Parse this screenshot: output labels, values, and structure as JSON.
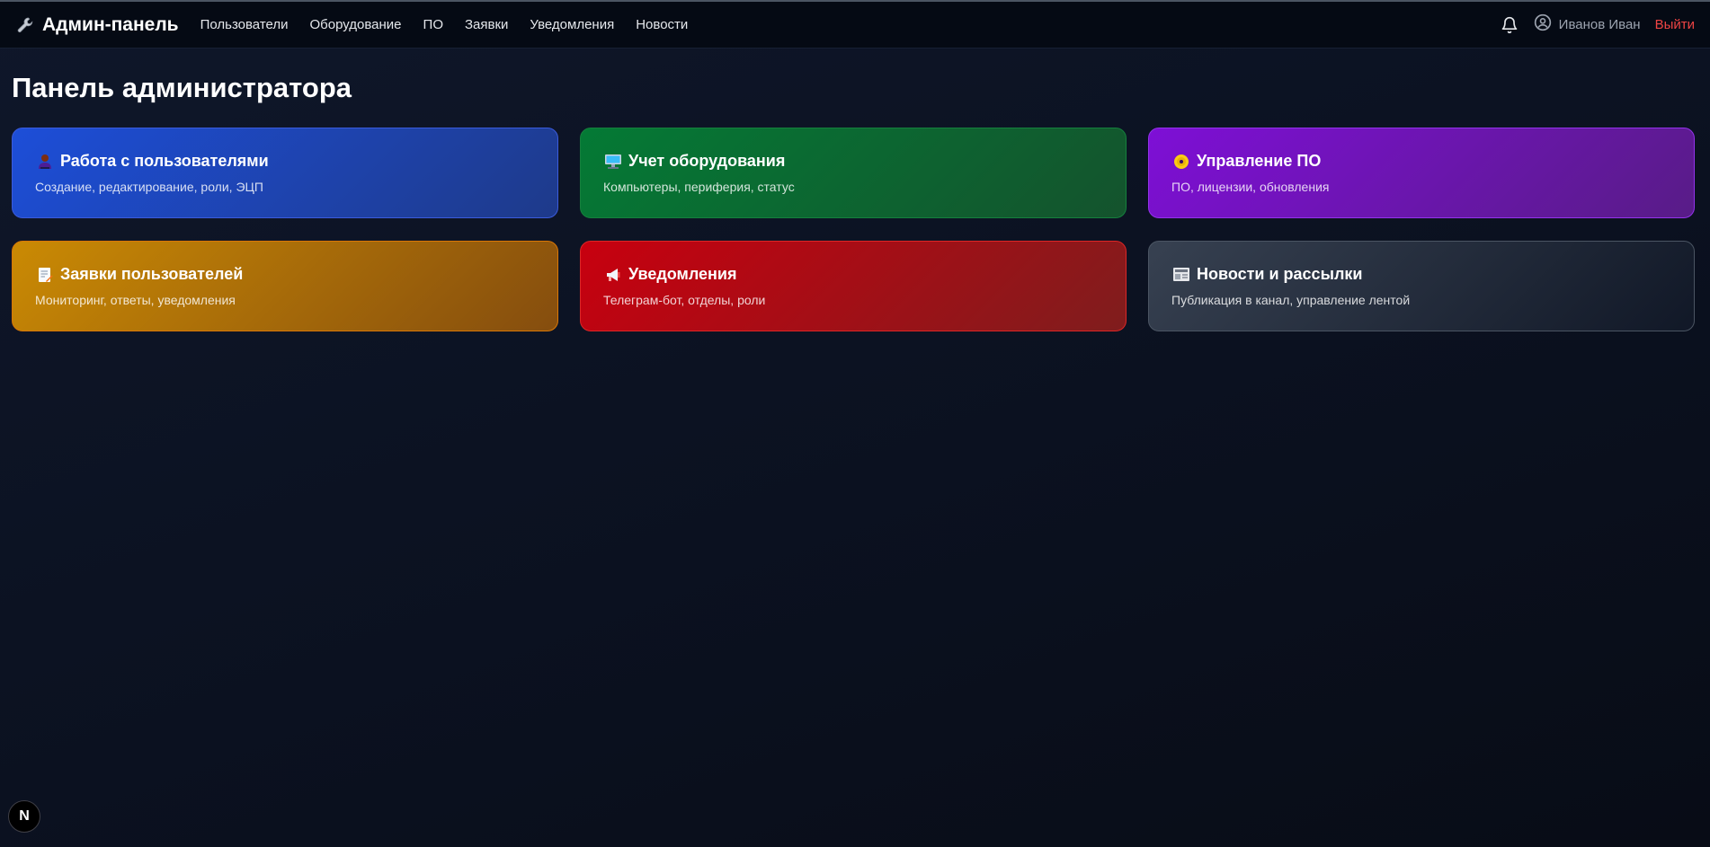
{
  "header": {
    "brand_title": "Админ-панель",
    "brand_icon": "wrench-icon",
    "nav": [
      {
        "label": "Пользователи"
      },
      {
        "label": "Оборудование"
      },
      {
        "label": "ПО"
      },
      {
        "label": "Заявки"
      },
      {
        "label": "Уведомления"
      },
      {
        "label": "Новости"
      }
    ],
    "user_name": "Иванов Иван",
    "logout_label": "Выйти"
  },
  "main": {
    "page_title": "Панель администратора",
    "cards": [
      {
        "title": "Работа с пользователями",
        "description": "Создание, редактирование, роли, ЭЦП",
        "icon": "user-icon",
        "color": "#1d4ed8"
      },
      {
        "title": "Учет оборудования",
        "description": "Компьютеры, периферия, статус",
        "icon": "computer-icon",
        "color": "#047a35"
      },
      {
        "title": "Управление ПО",
        "description": "ПО, лицензии, обновления",
        "icon": "disc-icon",
        "color": "#7e0fd6"
      },
      {
        "title": "Заявки пользователей",
        "description": "Мониторинг, ответы, уведомления",
        "icon": "memo-icon",
        "color": "#ca8a04"
      },
      {
        "title": "Уведомления",
        "description": "Телеграм-бот, отделы, роли",
        "icon": "megaphone-icon",
        "color": "#c8000f"
      },
      {
        "title": "Новости и рассылки",
        "description": "Публикация в канал, управление лентой",
        "icon": "newspaper-icon",
        "color": "#374151"
      }
    ]
  },
  "dev_badge": {
    "label": "N"
  },
  "colors": {
    "logout": "#ef4444",
    "background": "#0b1120"
  }
}
